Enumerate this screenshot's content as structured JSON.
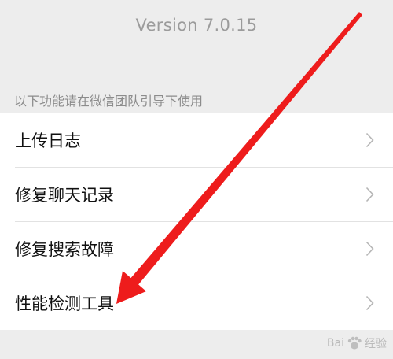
{
  "header": {
    "version": "Version 7.0.15"
  },
  "section": {
    "hint": "以下功能请在微信团队引导下使用"
  },
  "menu": {
    "items": [
      {
        "label": "上传日志"
      },
      {
        "label": "修复聊天记录"
      },
      {
        "label": "修复搜索故障"
      },
      {
        "label": "性能检测工具"
      }
    ]
  },
  "watermark": {
    "text": "Bai",
    "text2": "经验"
  },
  "colors": {
    "background": "#ededed",
    "list": "#ffffff",
    "arrow": "#ee1c1c",
    "text": "#111111",
    "muted": "#9b9b9b"
  },
  "icons": {
    "row_chevron": "chevron-right-icon",
    "annotation": "red-arrow-icon"
  }
}
